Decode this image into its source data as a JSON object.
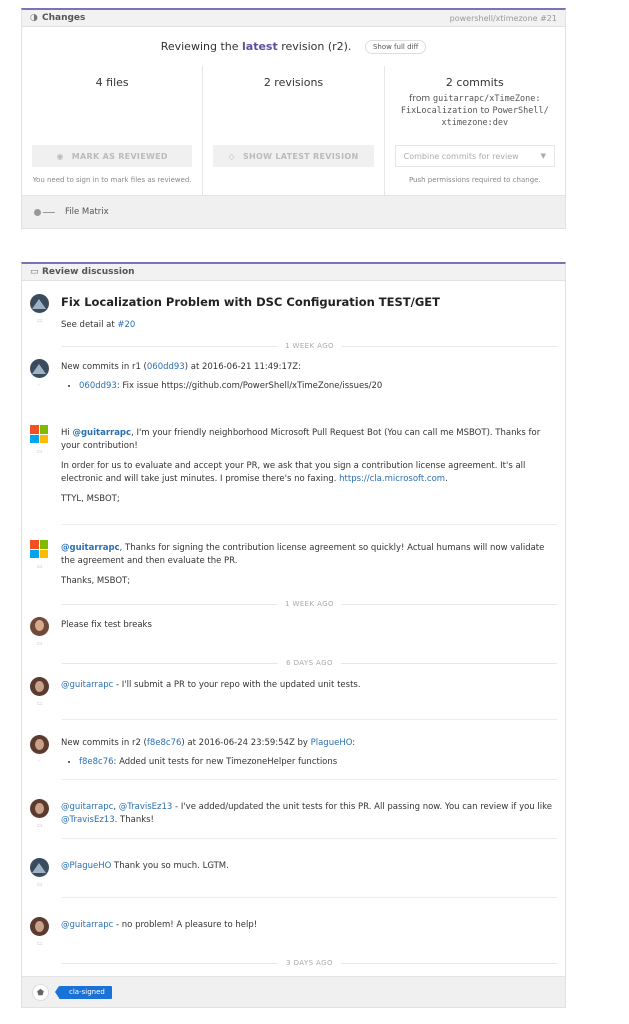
{
  "changes": {
    "header_title": "Changes",
    "repo_ref": "powershell/xtimezone #21",
    "reviewing_prefix": "Reviewing the ",
    "reviewing_latest": "latest",
    "reviewing_suffix": " revision (r2).",
    "show_full_diff": "Show full diff",
    "files_count": "4 files",
    "revisions_count": "2 revisions",
    "commits_count": "2 commits",
    "from_word": "from",
    "from_branch": "guitarrapc/xTimeZone:",
    "from_branch2": "FixLocalization",
    "to_word": "to",
    "to_repo": "PowerShell/",
    "to_branch": "xtimezone:dev",
    "mark_reviewed": "MARK AS REVIEWED",
    "show_latest": "SHOW LATEST REVISION",
    "combine_commits": "Combine commits for review",
    "sign_in_note": "You need to sign in to mark files as reviewed.",
    "push_note": "Push permissions required to change.",
    "file_matrix": "File Matrix"
  },
  "discussion": {
    "header_title": "Review discussion",
    "pr_title": "Fix Localization Problem with DSC Configuration TEST/GET",
    "detail_prefix": "See detail at ",
    "detail_link": "#20",
    "sep1": "1 WEEK AGO",
    "c1_prefix": "New commits in r1 (",
    "c1_sha": "060dd93",
    "c1_suffix": ") at 2016-06-21 11:49:17Z:",
    "c1_item_sha": "060dd93",
    "c1_item_text": ": Fix issue https://github.com/PowerShell/xTimeZone/issues/20",
    "m1_greet": "Hi ",
    "m1_mention": "@guitarrapc",
    "m1_text": ", I'm your friendly neighborhood Microsoft Pull Request Bot (You can call me MSBOT). Thanks for your contribution!",
    "m1_p2": "In order for us to evaluate and accept your PR, we ask that you sign a contribution license agreement. It's all electronic and will take just minutes. I promise there's no faxing. ",
    "m1_link": "https://cla.microsoft.com",
    "m1_p2_end": ".",
    "m1_sign": "TTYL, MSBOT;",
    "m2_mention": "@guitarrapc",
    "m2_text": ", Thanks for signing the contribution license agreement so quickly! Actual humans will now validate the agreement and then evaluate the PR.",
    "m2_sign": "Thanks, MSBOT;",
    "sep2": "1 WEEK AGO",
    "m3_text": "Please fix test breaks",
    "sep3": "6 DAYS AGO",
    "m4_mention": "@guitarrapc",
    "m4_text": " - I'll submit a PR to your repo with the updated unit tests.",
    "c2_prefix": "New commits in r2 (",
    "c2_sha": "f8e8c76",
    "c2_mid": ") at 2016-06-24 23:59:54Z by ",
    "c2_author": "PlagueHO",
    "c2_colon": ":",
    "c2_item_sha": "f8e8c76",
    "c2_item_text": ": Added unit tests for new TimezoneHelper functions",
    "m5_mention1": "@guitarrapc",
    "m5_comma": ", ",
    "m5_mention2": "@TravisEz13",
    "m5_text": " - I've added/updated the unit tests for this PR. All passing now. You can review if you like ",
    "m5_mention3": "@TravisEz13",
    "m5_end": ". Thanks!",
    "m6_mention": "@PlagueHO",
    "m6_text": " Thank you so much. LGTM.",
    "m7_mention": "@guitarrapc",
    "m7_text": " - no problem! A pleasure to help!",
    "sep4": "3 DAYS AGO",
    "label": "cla-signed"
  },
  "colors": {
    "accent": "#7b73b8",
    "link": "#2a6fb3",
    "label": "#1a72d8"
  }
}
